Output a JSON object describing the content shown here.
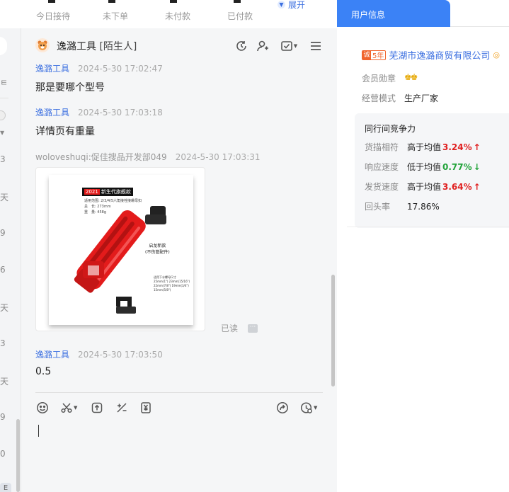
{
  "stats": {
    "items": [
      {
        "label": "今日接待"
      },
      {
        "label": "未下单"
      },
      {
        "label": "未付款"
      },
      {
        "label": "已付款"
      }
    ],
    "expand_label": "展开"
  },
  "left_strip": {
    "digits": [
      "3",
      "天",
      "9",
      "6",
      "天",
      "3",
      "天",
      "9",
      "0"
    ]
  },
  "chat": {
    "header": {
      "name": "逸潞工具",
      "tag": "[陌生人]"
    },
    "messages": [
      {
        "sender": "逸潞工具",
        "time": "2024-5-30 17:02:47",
        "text": "那是要哪个型号"
      },
      {
        "sender": "逸潞工具",
        "time": "2024-5-30 17:03:18",
        "text": "详情页有重量"
      },
      {
        "sender": "woloveshuqi:促佳搜品开发部049",
        "time": "2024-5-30 17:03:31"
      },
      {
        "sender": "逸潞工具",
        "time": "2024-5-30 17:03:50",
        "text": "0.5"
      }
    ],
    "image": {
      "badge_year": "2021",
      "badge_text": "新生代旗舰款",
      "spec1": "适用范围: 2/3/4/5六角接栓接螺母扣",
      "spec2": "总　长: 273mm",
      "spec3": "重　量: 458g",
      "caption1": "启龙新款",
      "caption2": "(不伤管配件)",
      "note": "适用下水螺母尺寸 25mm(1\") 23mm(15/16\") 22mm(7/8\") 19mm(3/4\") 15mm(5/8\")"
    },
    "read_status": "已读"
  },
  "right_panel": {
    "tab_label": "用户信息",
    "company": {
      "years_badge": "5年",
      "name": "芜湖市逸潞商贸有限公司"
    },
    "member_label": "会员勋章",
    "business_label": "经营模式",
    "business_value": "生产厂家",
    "competitiveness": {
      "title": "同行间竞争力",
      "metrics": [
        {
          "label": "货描相符",
          "compare": "高于均值",
          "value": "3.24%",
          "arrow": "↑",
          "trend": "up"
        },
        {
          "label": "响应速度",
          "compare": "低于均值",
          "value": "0.77%",
          "arrow": "↓",
          "trend": "down"
        },
        {
          "label": "发货速度",
          "compare": "高于均值",
          "value": "3.64%",
          "arrow": "↑",
          "trend": "up"
        },
        {
          "label": "回头率",
          "value": "17.86%"
        }
      ]
    }
  },
  "colors": {
    "accent": "#3b82f6",
    "link": "#3b6fe0",
    "up": "#e02020",
    "down": "#22a33a",
    "product_red": "#e31b1b"
  }
}
